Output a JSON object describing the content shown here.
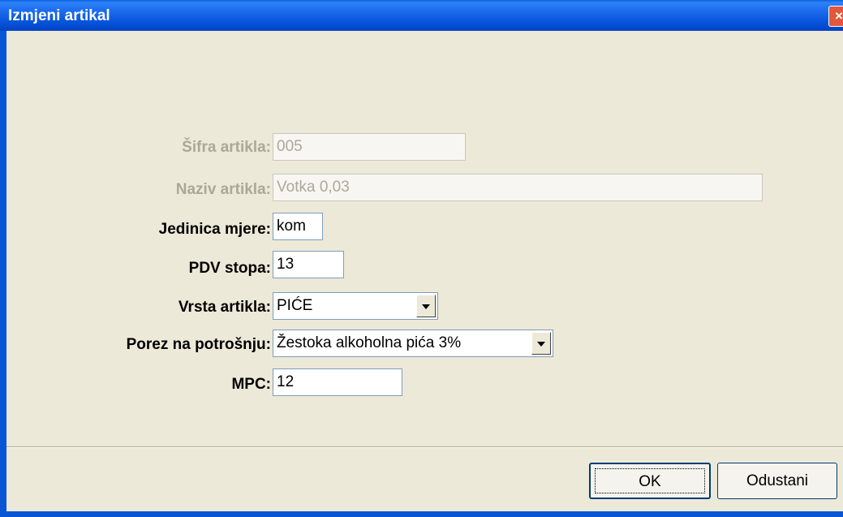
{
  "window": {
    "title": "Izmjeni artikal",
    "close_icon": "×"
  },
  "fields": {
    "sifra": {
      "label": "Šifra artikla:",
      "value": "005"
    },
    "naziv": {
      "label": "Naziv artikla:",
      "value": "Votka 0,03"
    },
    "jedinica": {
      "label": "Jedinica mjere:",
      "value": "kom"
    },
    "pdv": {
      "label": "PDV stopa:",
      "value": "13"
    },
    "vrsta": {
      "label": "Vrsta artikla:",
      "value": "PIĆE"
    },
    "porez": {
      "label": "Porez na potrošnju:",
      "value": "Žestoka alkoholna pića 3%"
    },
    "mpc": {
      "label": "MPC:",
      "value": "12"
    }
  },
  "buttons": {
    "ok": "OK",
    "cancel": "Odustani"
  }
}
